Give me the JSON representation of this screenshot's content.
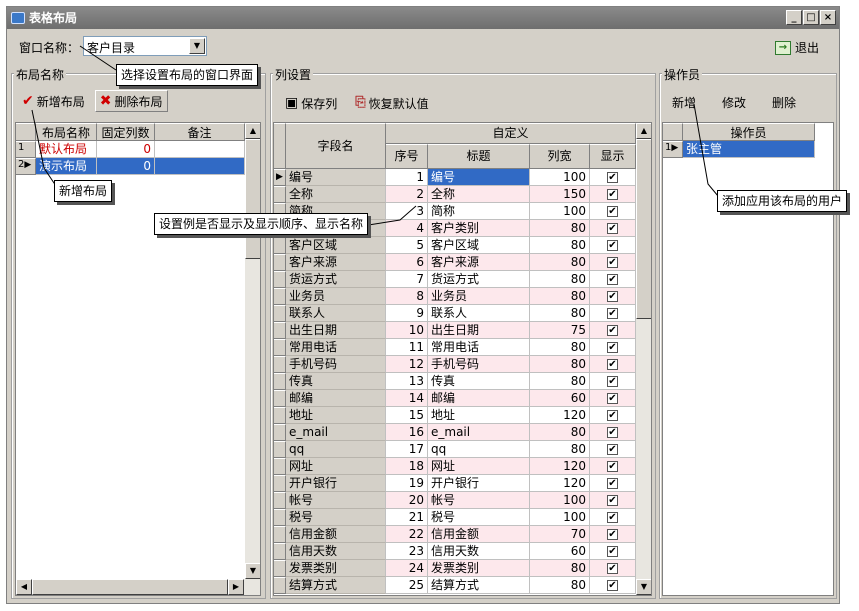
{
  "window": {
    "title": "表格布局"
  },
  "toolbar": {
    "window_name_label": "窗口名称：",
    "window_name_value": "客户目录",
    "exit_label": "退出"
  },
  "layout_panel": {
    "title": "布局名称",
    "add_label": "新增布局",
    "delete_label": "删除布局",
    "headers": [
      "布局名称",
      "固定列数",
      "备注"
    ],
    "rows": [
      {
        "index": "1",
        "name": "默认布局",
        "fixed": "0",
        "note": ""
      },
      {
        "index": "2",
        "name": "演示布局",
        "fixed": "0",
        "note": ""
      }
    ]
  },
  "column_panel": {
    "title": "列设置",
    "save_label": "保存列",
    "restore_label": "恢复默认值",
    "header_field": "字段名",
    "header_custom": "自定义",
    "header_seq": "序号",
    "header_title": "标题",
    "header_width": "列宽",
    "header_show": "显示",
    "rows": [
      {
        "field": "编号",
        "seq": "1",
        "title": "编号",
        "width": "100"
      },
      {
        "field": "全称",
        "seq": "2",
        "title": "全称",
        "width": "150"
      },
      {
        "field": "简称",
        "seq": "3",
        "title": "简称",
        "width": "100"
      },
      {
        "field": "客户类别",
        "seq": "4",
        "title": "客户类别",
        "width": "80"
      },
      {
        "field": "客户区域",
        "seq": "5",
        "title": "客户区域",
        "width": "80"
      },
      {
        "field": "客户来源",
        "seq": "6",
        "title": "客户来源",
        "width": "80"
      },
      {
        "field": "货运方式",
        "seq": "7",
        "title": "货运方式",
        "width": "80"
      },
      {
        "field": "业务员",
        "seq": "8",
        "title": "业务员",
        "width": "80"
      },
      {
        "field": "联系人",
        "seq": "9",
        "title": "联系人",
        "width": "80"
      },
      {
        "field": "出生日期",
        "seq": "10",
        "title": "出生日期",
        "width": "75"
      },
      {
        "field": "常用电话",
        "seq": "11",
        "title": "常用电话",
        "width": "80"
      },
      {
        "field": "手机号码",
        "seq": "12",
        "title": "手机号码",
        "width": "80"
      },
      {
        "field": "传真",
        "seq": "13",
        "title": "传真",
        "width": "80"
      },
      {
        "field": "邮编",
        "seq": "14",
        "title": "邮编",
        "width": "60"
      },
      {
        "field": "地址",
        "seq": "15",
        "title": "地址",
        "width": "120"
      },
      {
        "field": "e_mail",
        "seq": "16",
        "title": "e_mail",
        "width": "80"
      },
      {
        "field": "qq",
        "seq": "17",
        "title": "qq",
        "width": "80"
      },
      {
        "field": "网址",
        "seq": "18",
        "title": "网址",
        "width": "120"
      },
      {
        "field": "开户银行",
        "seq": "19",
        "title": "开户银行",
        "width": "120"
      },
      {
        "field": "帐号",
        "seq": "20",
        "title": "帐号",
        "width": "100"
      },
      {
        "field": "税号",
        "seq": "21",
        "title": "税号",
        "width": "100"
      },
      {
        "field": "信用金额",
        "seq": "22",
        "title": "信用金额",
        "width": "70"
      },
      {
        "field": "信用天数",
        "seq": "23",
        "title": "信用天数",
        "width": "60"
      },
      {
        "field": "发票类别",
        "seq": "24",
        "title": "发票类别",
        "width": "80"
      },
      {
        "field": "结算方式",
        "seq": "25",
        "title": "结算方式",
        "width": "80"
      }
    ]
  },
  "operator_panel": {
    "title": "操作员",
    "add_label": "新增",
    "edit_label": "修改",
    "delete_label": "删除",
    "header": "操作员",
    "rows": [
      {
        "index": "1",
        "name": "张主管"
      }
    ]
  },
  "callouts": {
    "select_window": "选择设置布局的窗口界面",
    "add_layout": "新增布局",
    "column_settings": "设置例是否显示及显示顺序、显示名称",
    "add_user": "添加应用该布局的用户"
  },
  "colors": {
    "selected_row": "#316ac5",
    "default_layout_text": "#cc0000",
    "alt_row": "#fde8ec"
  }
}
